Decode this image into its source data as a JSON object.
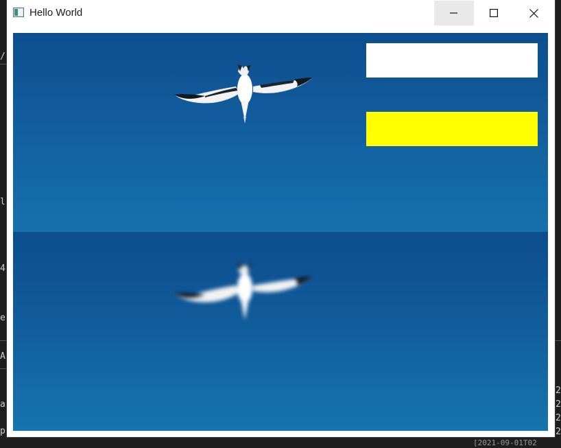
{
  "window": {
    "title": "Hello World",
    "icon": "qt-window-icon",
    "controls": {
      "minimize": "minimize-icon",
      "maximize": "maximize-icon",
      "close": "close-icon"
    }
  },
  "background_terminal": {
    "left_chars": [
      "/",
      "l",
      "4",
      "e",
      "A",
      "a",
      "p"
    ],
    "right_chars": [
      "2",
      "2",
      "2",
      "2"
    ],
    "bottom_fragment": "[2021-09-01T02"
  },
  "content": {
    "top_view": "original-video-frame",
    "bottom_view": "blurred-video-frame",
    "overlay_colors": {
      "white_rect": "#ffffff",
      "yellow_rect": "#ffff00"
    },
    "sky_color": "#125d9e"
  }
}
